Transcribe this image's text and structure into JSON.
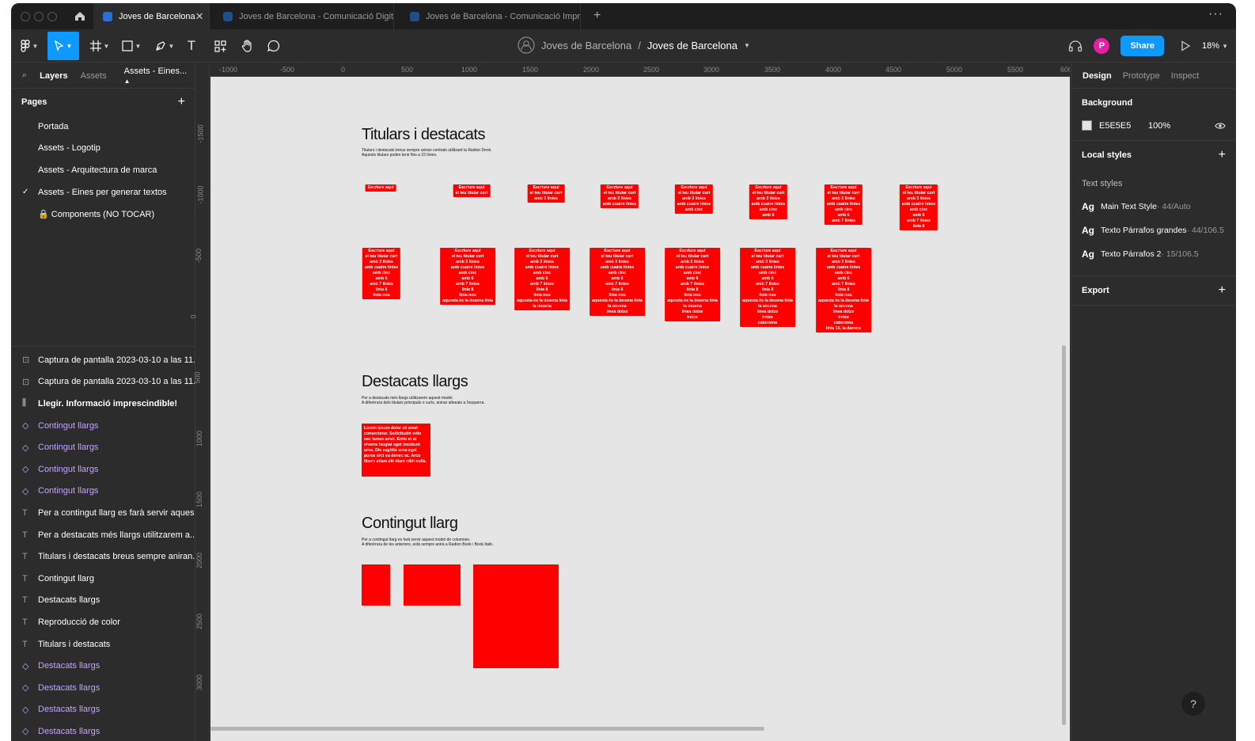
{
  "tabs": [
    {
      "label": "Joves de Barcelona",
      "active": true
    },
    {
      "label": "Joves de Barcelona - Comunicació Digital"
    },
    {
      "label": "Joves de Barcelona - Comunicació Impres"
    }
  ],
  "toolbar": {
    "crumb_team": "Joves de Barcelona",
    "crumb_sep": "/",
    "crumb_file": "Joves de Barcelona",
    "share": "Share",
    "zoom": "18%",
    "avatar": "P"
  },
  "left": {
    "tab_layers": "Layers",
    "tab_assets": "Assets",
    "tab_page": "Assets - Eines...",
    "pages_title": "Pages",
    "pages": [
      "Portada",
      "Assets - Logotip",
      "Assets - Arquitectura de marca",
      "Assets - Eines per generar textos",
      "🔒 Components (NO TOCAR)"
    ],
    "layers": [
      {
        "label": "Captura de pantalla 2023-03-10 a las 11...",
        "type": "image"
      },
      {
        "label": "Captura de pantalla 2023-03-10 a las 11...",
        "type": "image"
      },
      {
        "label": "Llegir. Informació imprescindible!",
        "type": "frame"
      },
      {
        "label": "Contingut llargs",
        "type": "comp"
      },
      {
        "label": "Contingut llargs",
        "type": "comp"
      },
      {
        "label": "Contingut llargs",
        "type": "comp"
      },
      {
        "label": "Contingut llargs",
        "type": "comp"
      },
      {
        "label": "Per a contingut llarg es farà servir aques...",
        "type": "text"
      },
      {
        "label": "Per a destacats més llargs utilitzarem a...",
        "type": "text"
      },
      {
        "label": "Titulars i destacats breus sempre aniran...",
        "type": "text"
      },
      {
        "label": "Contingut llarg",
        "type": "text"
      },
      {
        "label": "Destacats llargs",
        "type": "text"
      },
      {
        "label": "Reproducció de color",
        "type": "text"
      },
      {
        "label": "Titulars i destacats",
        "type": "text"
      },
      {
        "label": "Destacats llargs",
        "type": "comp"
      },
      {
        "label": "Destacats llargs",
        "type": "comp"
      },
      {
        "label": "Destacats llargs",
        "type": "comp"
      },
      {
        "label": "Destacats llargs",
        "type": "comp"
      }
    ]
  },
  "rulers": {
    "h": [
      "-1000",
      "-500",
      "0",
      "500",
      "1000",
      "1500",
      "2000",
      "2500",
      "3000",
      "3500",
      "4000",
      "4500",
      "5000",
      "5500",
      "600"
    ],
    "v": [
      "-1500",
      "-1000",
      "-500",
      "0",
      "500",
      "1000",
      "1500",
      "2000",
      "2500",
      "3000"
    ]
  },
  "canvas": {
    "s1_title": "Titulars i destacats",
    "s1_desc": "Titulars i destacats breus sempre aniran centrats utilitzant la Radion Demi.\nAquests titulars poden tenir fins a 15 línies.",
    "s2_title": "Destacats llargs",
    "s2_desc": "Per a destacats més llargs utilitzarem aquest model.\nA diferència dels titulars principals o curts, aniran alineats a l'esquerra.",
    "s2_block": "Lorem ipsum dolor sit amet consectetur. Sollicitudin odio nec lames amet. Enim et at viverra feugiat eget tincidunt urna. Dis sagittis urna eget purus orci eu donec ac. Arcu libero etiam elit diam nibh nulla.",
    "s3_title": "Contingut llarg",
    "s3_desc": "Per a contingut llarg es farà servir aquest model de columnes.\nA diferència de les anteriors, està sempre anirà a Radion Book i Book Italic.",
    "chip_lines": [
      "Escriure aquí",
      "el teu titular curt",
      "amb 3 línies",
      "amb cuatre línies",
      "amb cinc",
      "amb 6",
      "amb 7 línies",
      "línia 8",
      "línia nou",
      "aquesta és la desena línia",
      "la onzena",
      "línea dotze",
      "tretze",
      "catorzena",
      "línia 15, la darrera"
    ],
    "row1_counts": [
      1,
      2,
      3,
      4,
      5,
      6,
      7,
      8
    ],
    "row2_counts": [
      9,
      10,
      11,
      12,
      13,
      14,
      15
    ]
  },
  "right": {
    "tab_design": "Design",
    "tab_prototype": "Prototype",
    "tab_inspect": "Inspect",
    "background_title": "Background",
    "bg_hex": "E5E5E5",
    "bg_opacity": "100%",
    "bg_color": "#e5e5e5",
    "local_styles": "Local styles",
    "text_styles": "Text styles",
    "styles": [
      {
        "ag": "Ag",
        "name": "Main Text Style",
        "meta": " · 44/Auto"
      },
      {
        "ag": "Ag",
        "name": "Texto Párrafos grandes",
        "meta": " · 44/106.5"
      },
      {
        "ag": "Ag",
        "name": "Texto Párrafos 2",
        "meta": " · 15/106.5"
      }
    ],
    "export": "Export"
  },
  "help": "?"
}
